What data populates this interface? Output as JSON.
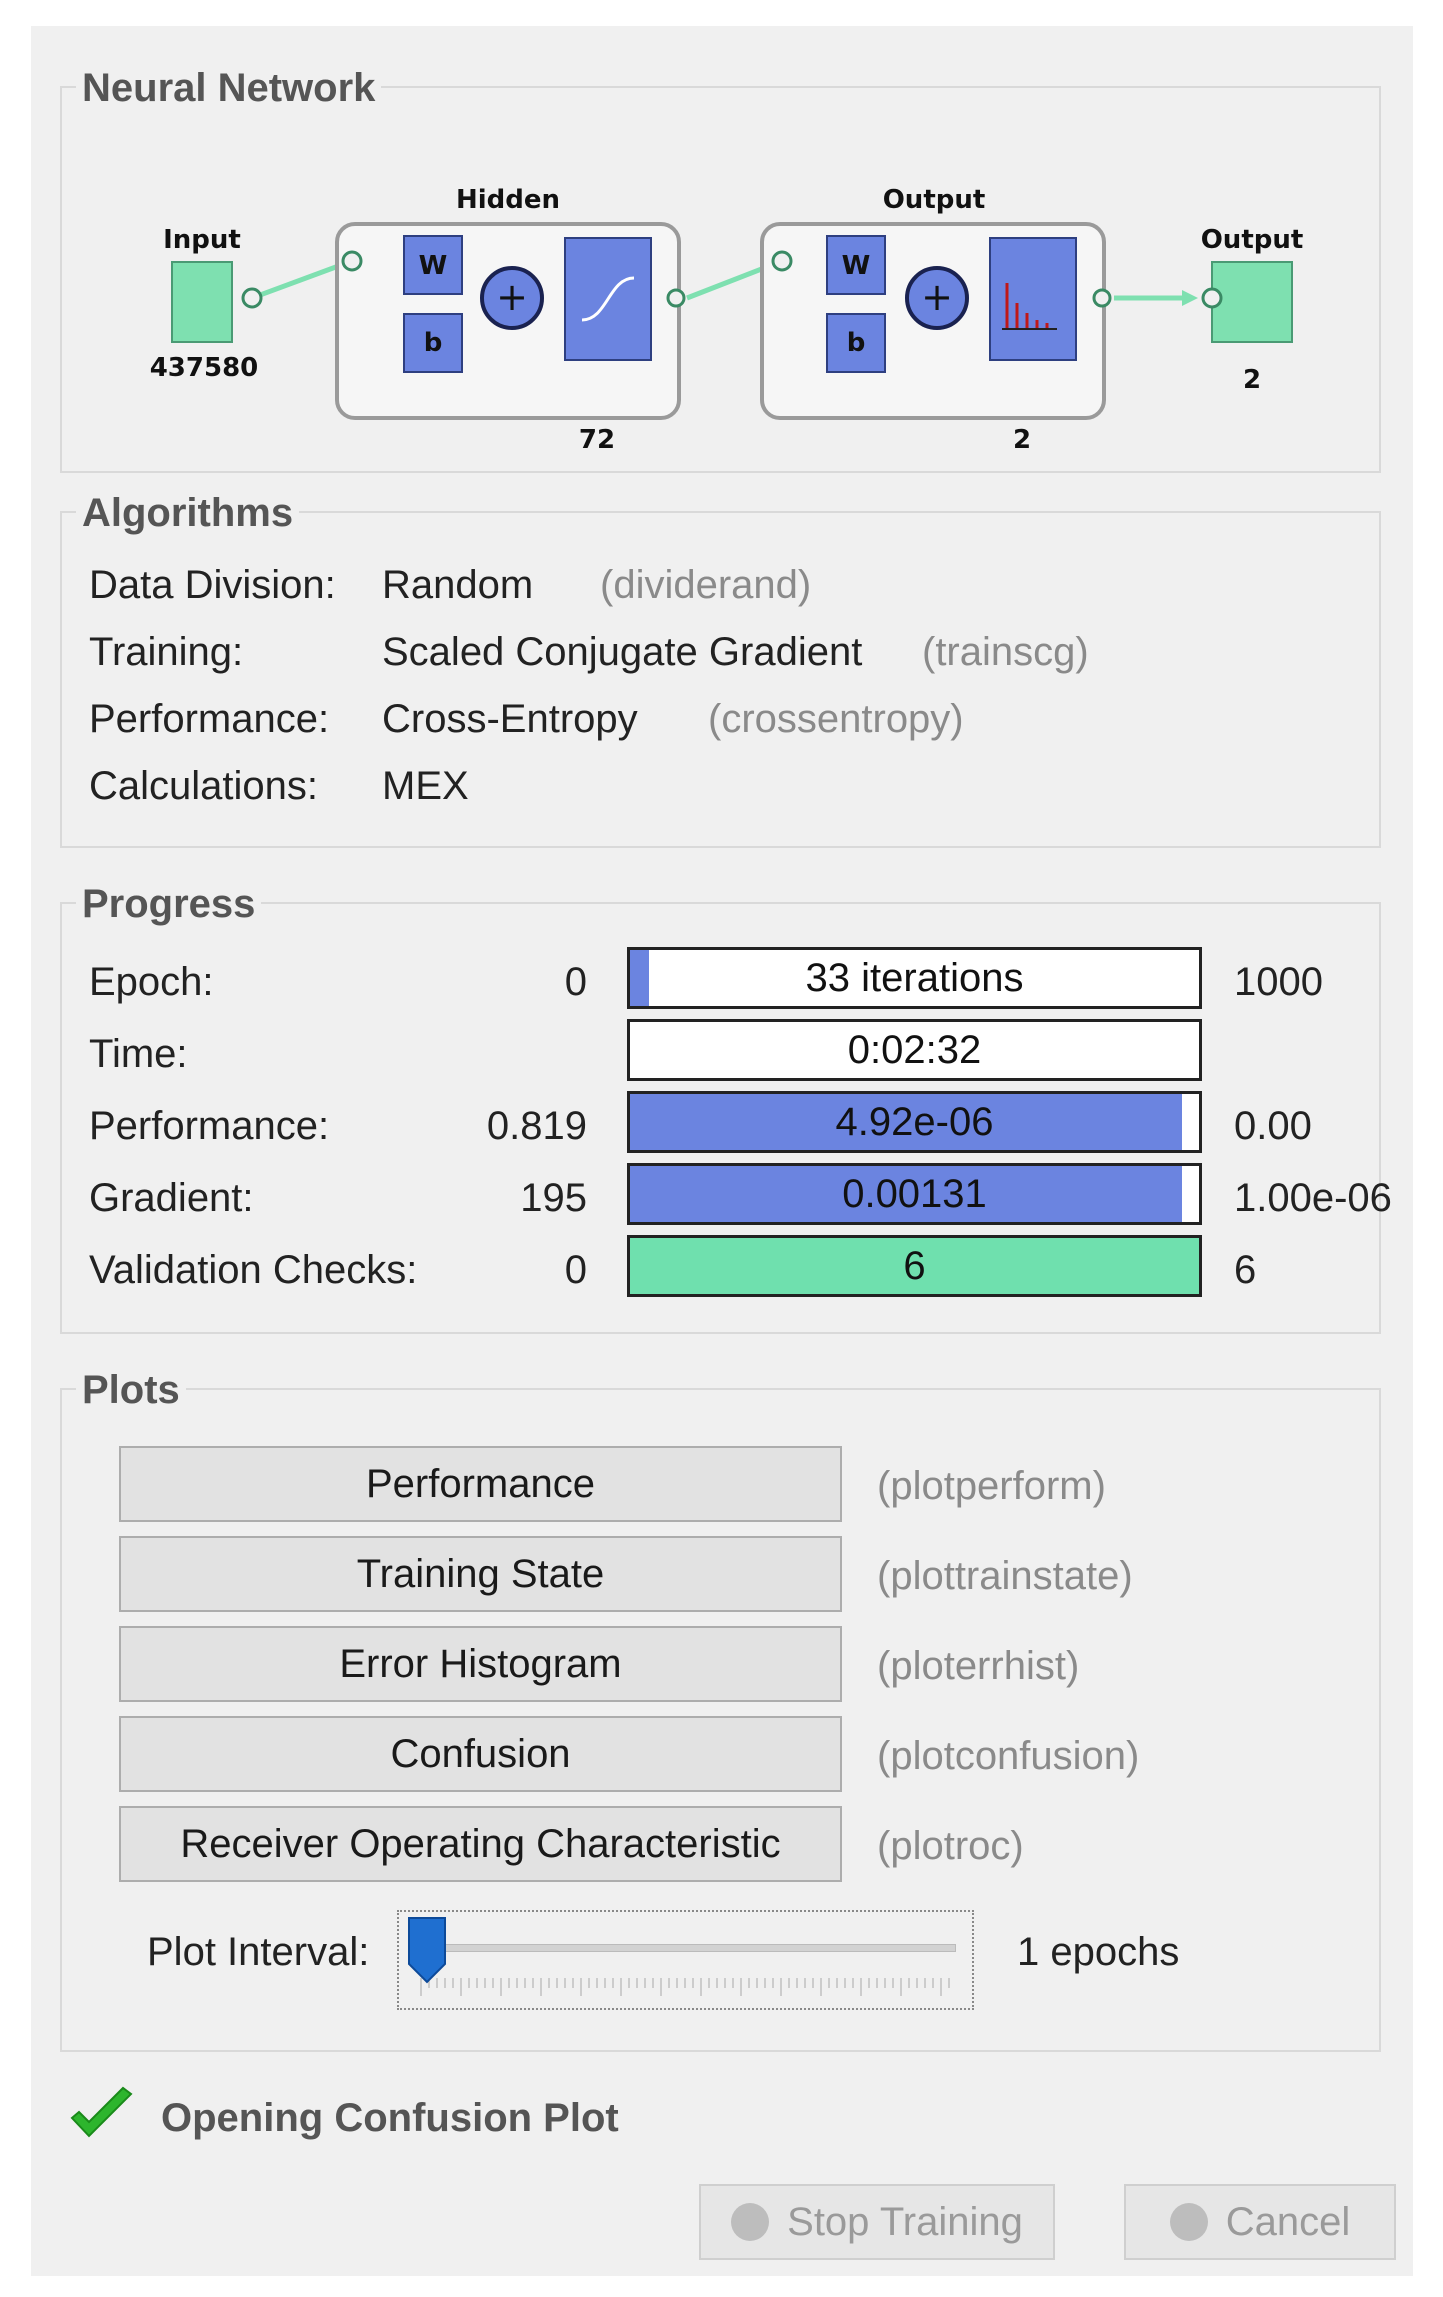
{
  "neural_network": {
    "title": "Neural Network",
    "input_label": "Input",
    "input_size": "437580",
    "hidden_label": "Hidden",
    "hidden_size": "72",
    "output_layer_label": "Output",
    "output_layer_size": "2",
    "output_label": "Output",
    "output_size": "2",
    "weight_label": "W",
    "bias_label": "b",
    "plus_symbol": "+",
    "node_color": "#7ee0b0",
    "layer_color": "#6b84e0"
  },
  "algorithms": {
    "title": "Algorithms",
    "rows": [
      {
        "label": "Data Division:",
        "value": "Random",
        "fn": "(dividerand)"
      },
      {
        "label": "Training:",
        "value": "Scaled Conjugate Gradient",
        "fn": "(trainscg)"
      },
      {
        "label": "Performance:",
        "value": "Cross-Entropy",
        "fn": "(crossentropy)"
      },
      {
        "label": "Calculations:",
        "value": "MEX",
        "fn": ""
      }
    ]
  },
  "progress": {
    "title": "Progress",
    "rows": [
      {
        "label": "Epoch:",
        "start": "0",
        "bar_text": "33 iterations",
        "end": "1000",
        "fill": 0.033,
        "fill_color": "#6b84e0"
      },
      {
        "label": "Time:",
        "start": "",
        "bar_text": "0:02:32",
        "end": "",
        "fill": 0,
        "fill_color": "#6b84e0"
      },
      {
        "label": "Performance:",
        "start": "0.819",
        "bar_text": "4.92e-06",
        "end": "0.00",
        "fill": 0.97,
        "fill_color": "#6b84e0"
      },
      {
        "label": "Gradient:",
        "start": "195",
        "bar_text": "0.00131",
        "end": "1.00e-06",
        "fill": 0.97,
        "fill_color": "#6b84e0"
      },
      {
        "label": "Validation Checks:",
        "start": "0",
        "bar_text": "6",
        "end": "6",
        "fill": 1.0,
        "fill_color": "#6fe0ae"
      }
    ]
  },
  "plots": {
    "title": "Plots",
    "buttons": [
      {
        "label": "Performance",
        "fn": "(plotperform)"
      },
      {
        "label": "Training State",
        "fn": "(plottrainstate)"
      },
      {
        "label": "Error Histogram",
        "fn": "(ploterrhist)"
      },
      {
        "label": "Confusion",
        "fn": "(plotconfusion)"
      },
      {
        "label": "Receiver Operating Characteristic",
        "fn": "(plotroc)"
      }
    ],
    "interval_label": "Plot Interval:",
    "interval_value": "1 epochs",
    "slider_level": 0.0
  },
  "status": {
    "text": "Opening Confusion Plot",
    "icon": "checkmark-icon",
    "icon_color": "#2db52d"
  },
  "footer": {
    "stop_label": "Stop Training",
    "cancel_label": "Cancel"
  }
}
